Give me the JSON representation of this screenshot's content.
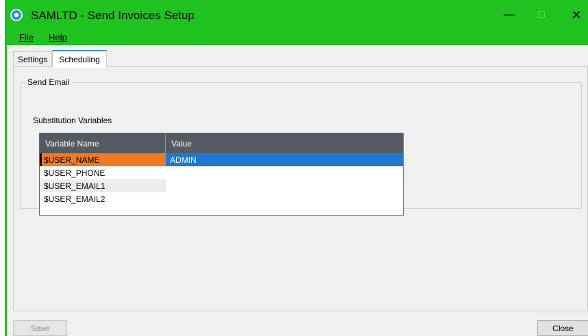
{
  "window": {
    "title": "SAMLTD - Send Invoices Setup",
    "controls": {
      "minimize": "—",
      "maximize": "□",
      "close": "✕"
    }
  },
  "menu": {
    "file": "File",
    "help": "Help"
  },
  "tabs": [
    {
      "label": "Settings",
      "active": false
    },
    {
      "label": "Scheduling",
      "active": true
    }
  ],
  "send_email": {
    "group_title": "Send Email",
    "substitution_label": "Substitution Variables",
    "columns": [
      "Variable Name",
      "Value"
    ],
    "rows": [
      {
        "name": "$USER_NAME",
        "value": "ADMIN",
        "selected": true
      },
      {
        "name": "$USER_PHONE",
        "value": ""
      },
      {
        "name": "$USER_EMAIL1",
        "value": ""
      },
      {
        "name": "$USER_EMAIL2",
        "value": ""
      }
    ]
  },
  "buttons": {
    "save": "Save",
    "close": "Close"
  },
  "colors": {
    "titlebar": "#1fc21f",
    "selected_name": "#f07a24",
    "selected_value": "#1e78d2",
    "grid_header": "#555a62"
  }
}
